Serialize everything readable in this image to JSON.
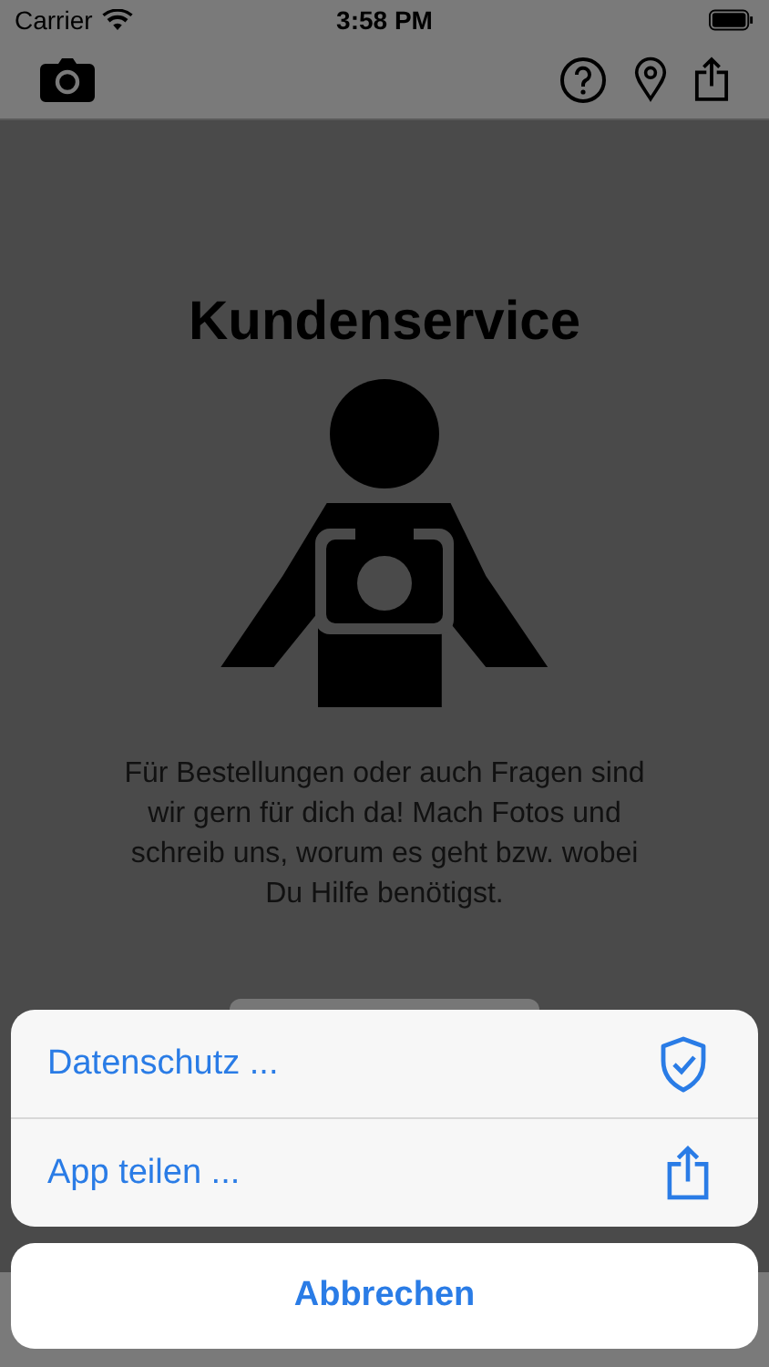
{
  "status_bar": {
    "carrier": "Carrier",
    "time": "3:58 PM"
  },
  "page": {
    "title": "Kundenservice",
    "description": "Für Bestellungen oder auch Fragen sind wir gern für dich da! Mach Fotos und schreib uns, worum es geht bzw. wobei Du Hilfe benötigst."
  },
  "action_sheet": {
    "items": [
      {
        "label": "Datenschutz ...",
        "kind": "privacy"
      },
      {
        "label": "App teilen ...",
        "kind": "share"
      }
    ],
    "cancel": "Abbrechen"
  }
}
